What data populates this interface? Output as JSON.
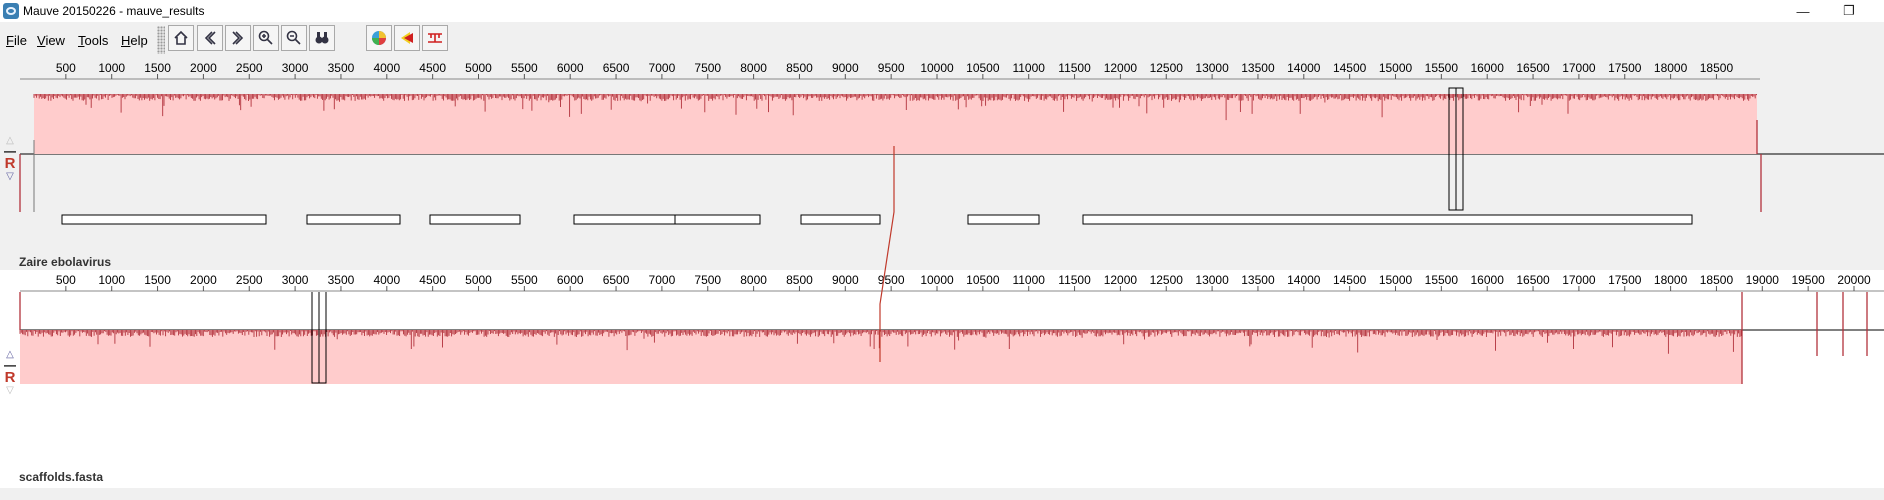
{
  "window": {
    "title": "Mauve 20150226 - mauve_results",
    "minimize_glyph": "—",
    "restore_glyph": "❐"
  },
  "menu": [
    {
      "pre": "",
      "ul": "F",
      "post": "ile"
    },
    {
      "pre": "",
      "ul": "V",
      "post": "iew"
    },
    {
      "pre": "",
      "ul": "T",
      "post": "ools"
    },
    {
      "pre": "",
      "ul": "H",
      "post": "elp"
    }
  ],
  "toolbar": {
    "icons": [
      "home-icon",
      "scroll-left-icon",
      "scroll-right-icon",
      "zoom-in-icon",
      "zoom-out-icon",
      "find-icon",
      "color-scheme-icon",
      "lcb-weight-icon",
      "alignment-view-icon"
    ]
  },
  "genomes": [
    {
      "name": "Zaire ebolavirus",
      "ruler": {
        "start": 500,
        "step": 500,
        "end": 18500
      },
      "length": 18959,
      "reverse_label": "R"
    },
    {
      "name": "scaffolds.fasta",
      "ruler": {
        "start": 500,
        "step": 500,
        "end": 20000
      },
      "length": 20350,
      "reverse_label": "R"
    }
  ],
  "colors": {
    "lcb_fill": "#ffcccc",
    "lcb_edge": "#b2323c",
    "connector": "#c0392b"
  }
}
